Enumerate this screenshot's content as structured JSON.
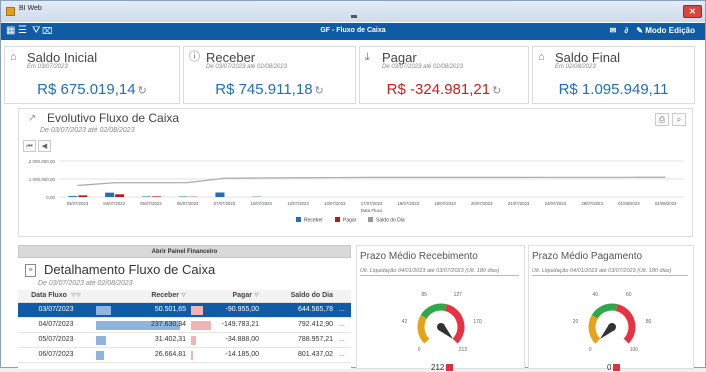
{
  "window": {
    "title": "BI Web",
    "close_label": "✕"
  },
  "toolbar": {
    "title": "GF - Fluxo de Caixa",
    "edit_mode_label": "Modo Edição"
  },
  "kpis": [
    {
      "title": "Saldo Inicial",
      "sub": "Em 03/07/2023",
      "value": "R$ 675.019,14",
      "color": "#1f6fb5",
      "icon": "safe-icon"
    },
    {
      "title": "Receber",
      "sub": "De 03/07/2023 até 02/08/2023",
      "value": "R$ 745.911,18",
      "color": "#1f6fb5",
      "icon": "question-icon"
    },
    {
      "title": "Pagar",
      "sub": "De 03/07/2023 até 02/08/2023",
      "value": "R$ -324.981,21",
      "color": "#d01c1c",
      "icon": "download-icon"
    },
    {
      "title": "Saldo Final",
      "sub": "Em 02/08/2023",
      "value": "R$ 1.095.949,11",
      "color": "#1f6fb5",
      "icon": "safe-icon"
    }
  ],
  "evolutivo": {
    "title": "Evolutivo Fluxo de Caixa",
    "sub": "De 03/07/2023 até 02/08/2023"
  },
  "chart_data": {
    "type": "bar",
    "title": "Evolutivo Fluxo de Caixa",
    "xlabel": "Data Fluxo",
    "ylabel": "",
    "y_ticks": [
      "2.000.000,00",
      "1.000.000,00",
      "0,00"
    ],
    "ylim": [
      0,
      2000000
    ],
    "grid": true,
    "legend_position": "bottom",
    "categories": [
      "03/07/2023",
      "04/07/2023",
      "05/07/2023",
      "06/07/2023",
      "07/07/2023",
      "10/07/2023",
      "12/07/2023",
      "13/07/2023",
      "17/07/2023",
      "18/07/2023",
      "19/07/2023",
      "20/07/2023",
      "21/07/2023",
      "24/07/2023",
      "28/07/2023",
      "01/08/2023",
      "02/08/2023"
    ],
    "series": [
      {
        "name": "Receber",
        "type": "bar",
        "color": "#1f6fb5",
        "values": [
          50000,
          240000,
          30000,
          25000,
          250000,
          20000,
          0,
          0,
          0,
          0,
          0,
          0,
          0,
          0,
          0,
          0,
          0
        ]
      },
      {
        "name": "Pagar",
        "type": "bar",
        "color": "#b01c1c",
        "values": [
          90000,
          150000,
          35000,
          14000,
          0,
          0,
          0,
          0,
          0,
          0,
          0,
          0,
          0,
          0,
          0,
          0,
          0
        ]
      },
      {
        "name": "Saldo do Dia",
        "type": "line",
        "color": "#aaaaaa",
        "values": [
          640000,
          790000,
          790000,
          800000,
          1040000,
          1060000,
          1070000,
          1080000,
          1090000,
          1090000,
          1090000,
          1090000,
          1090000,
          1095000,
          1095000,
          1095000,
          1095949
        ]
      }
    ]
  },
  "financeiro": {
    "button_label": "Abrir Painel Financeiro"
  },
  "detalhamento": {
    "title": "Detalhamento Fluxo de Caixa",
    "sub": "De 03/07/2023 até 02/08/2023",
    "columns": {
      "date": "Data Fluxo",
      "rec": "Receber",
      "pag": "Pagar",
      "saldo": "Saldo do Dia"
    },
    "rows": [
      {
        "date": "03/07/2023",
        "rec": "50.501,65",
        "pag": "-90.955,00",
        "saldo": "644.565,78",
        "rec_frac": 0.18,
        "pag_frac": 0.55,
        "selected": true
      },
      {
        "date": "04/07/2023",
        "rec": "237.630,34",
        "pag": "-149.783,21",
        "saldo": "792.412,90",
        "rec_frac": 1.0,
        "pag_frac": 0.9,
        "selected": false
      },
      {
        "date": "05/07/2023",
        "rec": "31.402,31",
        "pag": "-34.888,00",
        "saldo": "788.957,21",
        "rec_frac": 0.12,
        "pag_frac": 0.22,
        "selected": false
      },
      {
        "date": "06/07/2023",
        "rec": "26.664,81",
        "pag": "-14.185,00",
        "saldo": "801.437,02",
        "rec_frac": 0.1,
        "pag_frac": 0.1,
        "selected": false
      }
    ]
  },
  "prazo_recebimento": {
    "title": "Prazo Médio Recebimento",
    "sub": "Ult. Liquidação 04/01/2023 até 03/07/2023 (Ult. 180 dias)",
    "ticks": [
      "85",
      "127",
      "42",
      "170",
      "0",
      "212"
    ],
    "value": "212",
    "max": 212
  },
  "prazo_pagamento": {
    "title": "Prazo Médio Pagamento",
    "sub": "Ult. Liquidação 04/01/2023 até 03/07/2023 (Ult. 180 dias)",
    "ticks": [
      "40",
      "60",
      "20",
      "80",
      "0",
      "100"
    ],
    "value": "0",
    "max": 100
  }
}
